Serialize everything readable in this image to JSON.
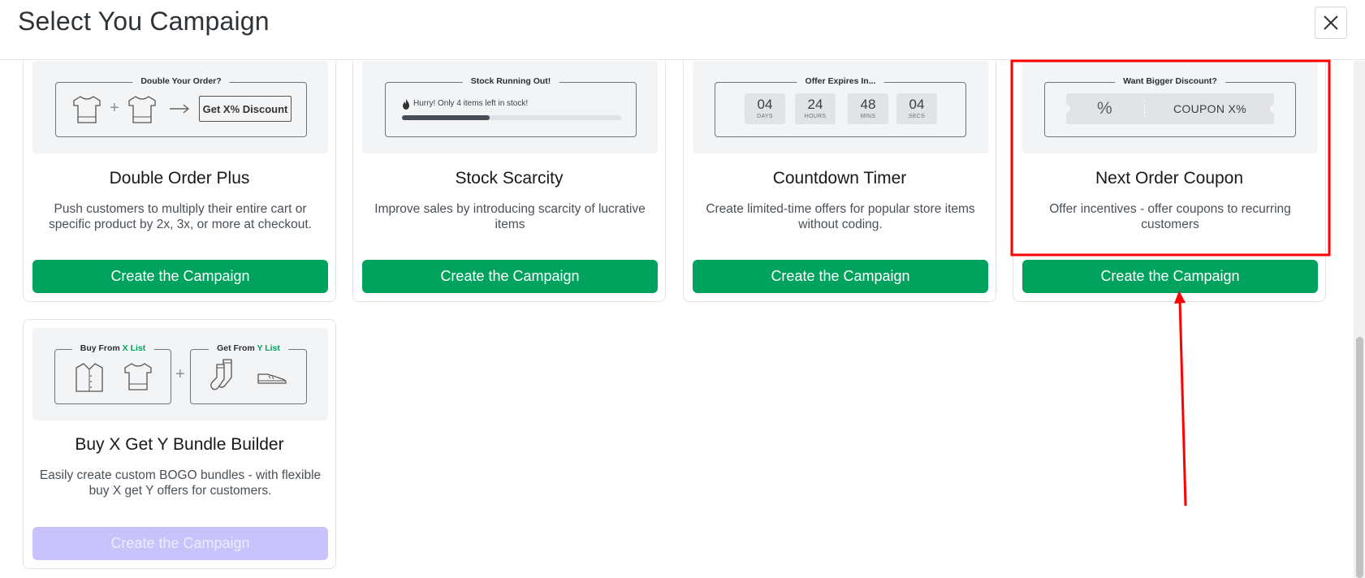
{
  "header": {
    "title": "Select You Campaign"
  },
  "cards": [
    {
      "title": "Double Order Plus",
      "desc": "Push customers to multiply their entire cart or specific product by 2x, 3x, or more at checkout.",
      "cta": "Create the Campaign",
      "preview": {
        "label": "Double Your Order?",
        "discount": "Get X% Discount"
      }
    },
    {
      "title": "Stock Scarcity",
      "desc": "Improve sales by introducing scarcity of lucrative items",
      "cta": "Create the Campaign",
      "preview": {
        "label": "Stock Running Out!",
        "message": "Hurry! Only 4 items left in stock!",
        "progress": 0.4
      }
    },
    {
      "title": "Countdown Timer",
      "desc": "Create limited-time offers for popular store items without coding.",
      "cta": "Create the Campaign",
      "preview": {
        "label": "Offer Expires In...",
        "units": [
          {
            "value": "04",
            "unit": "DAYS"
          },
          {
            "value": "24",
            "unit": "HOURS"
          },
          {
            "value": "48",
            "unit": "MINS"
          },
          {
            "value": "04",
            "unit": "SECS"
          }
        ]
      }
    },
    {
      "title": "Next Order Coupon",
      "desc": "Offer incentives - offer coupons to recurring customers",
      "cta": "Create the Campaign",
      "preview": {
        "label": "Want Bigger Discount?",
        "coupon": "COUPON X%"
      }
    },
    {
      "title": "Buy X Get Y Bundle Builder",
      "desc": "Easily create custom BOGO bundles - with flexible buy X get Y offers for customers.",
      "cta": "Create the Campaign",
      "preview": {
        "buy_prefix": "Buy From ",
        "buy_highlight": "X List",
        "get_prefix": "Get From ",
        "get_highlight": "Y List"
      }
    }
  ],
  "colors": {
    "primary": "#00a35e",
    "disabled": "#c9c3fb",
    "highlight": "#ff0000"
  },
  "icons": [
    "close-icon",
    "tshirt-icon",
    "plus-icon",
    "arrow-right-icon",
    "fire-icon",
    "percent-icon",
    "shirt-icon",
    "socks-icon",
    "shoe-icon"
  ]
}
